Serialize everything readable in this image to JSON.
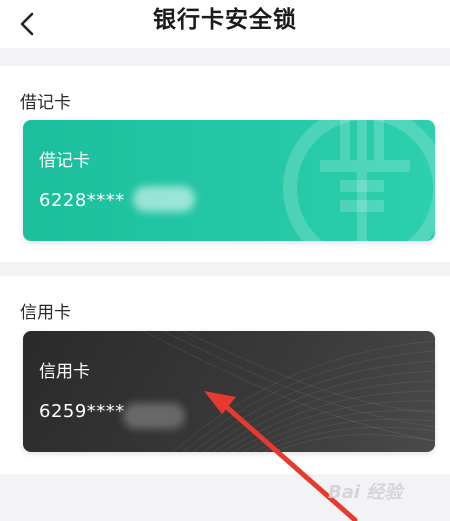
{
  "header": {
    "title": "银行卡安全锁",
    "back_icon": "chevron-left-icon"
  },
  "debit_section": {
    "label": "借记卡",
    "card": {
      "name": "借记卡",
      "number": "6228****",
      "color": "#1bbf9c",
      "logo_icon": "bank-logo-icon"
    }
  },
  "credit_section": {
    "label": "信用卡",
    "card": {
      "name": "信用卡",
      "number": "6259****",
      "color": "#2d2d2d"
    }
  },
  "annotation": {
    "arrow_color": "#e63a2e",
    "arrow_icon": "red-arrow-annotation"
  },
  "watermark": "Bai 经验"
}
